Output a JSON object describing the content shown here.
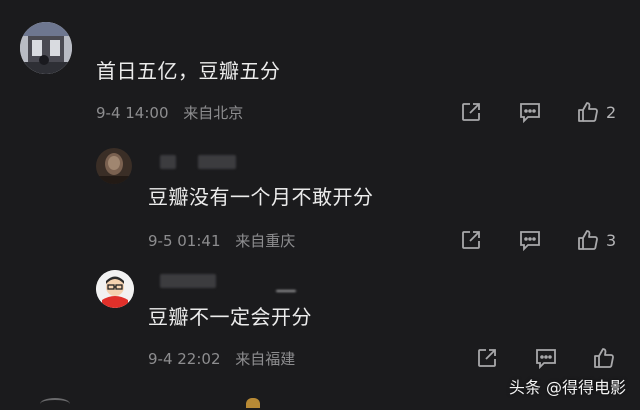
{
  "comments": [
    {
      "text": "首日五亿，豆瓣五分",
      "date": "9-4 14:00",
      "location": "来自北京",
      "likes": "2",
      "icons": [
        "share-icon",
        "reply-icon",
        "thumbs-up-icon"
      ]
    },
    {
      "text": "豆瓣没有一个月不敢开分",
      "date": "9-5 01:41",
      "location": "来自重庆",
      "likes": "3",
      "icons": [
        "share-icon",
        "reply-icon",
        "thumbs-up-icon"
      ]
    },
    {
      "text": "豆瓣不一定会开分",
      "date": "9-4 22:02",
      "location": "来自福建",
      "likes": "",
      "icons": [
        "share-icon",
        "reply-icon",
        "thumbs-up-icon"
      ]
    }
  ],
  "watermark": "头条 @得得电影",
  "colors": {
    "background": "#1b1b1d",
    "text": "#ececec",
    "meta": "#8d8d8f",
    "icon": "#a9a9ab"
  }
}
